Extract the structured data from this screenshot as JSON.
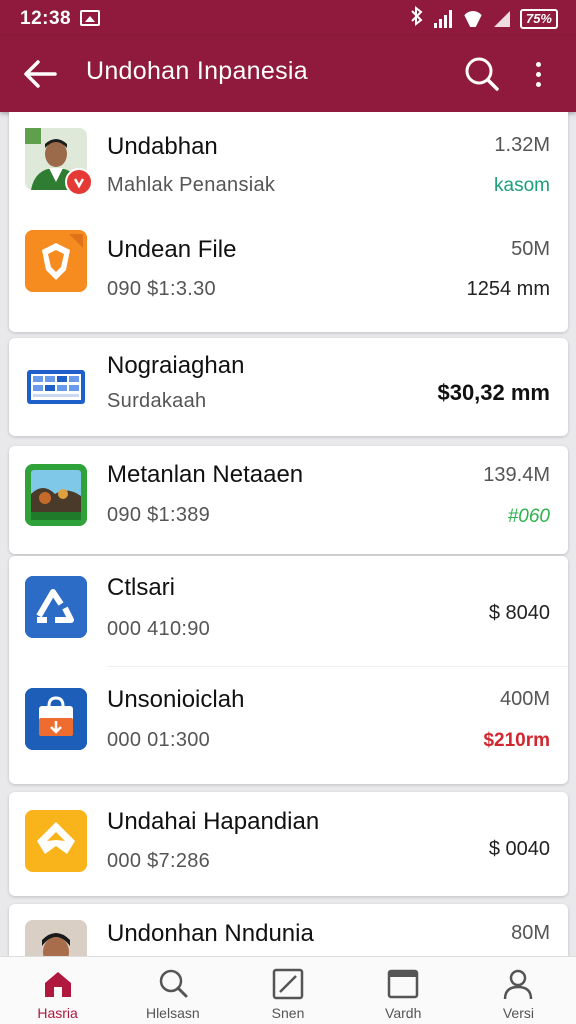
{
  "status_bar": {
    "time": "12:38",
    "battery": "75%"
  },
  "app_bar": {
    "title": "Undohan Inpanesia"
  },
  "items": [
    {
      "name": "Undabhan",
      "subtitle": "Mahlak Penansiak",
      "size": "1.32M",
      "value": "kasom",
      "icon": "avatar-photo"
    },
    {
      "name": "Undean File",
      "subtitle": "090 $1:3.30",
      "size": "50M",
      "value": "1254 mm",
      "icon": "shield-app-icon"
    },
    {
      "name": "Nograiaghan",
      "subtitle": "Surdakaah",
      "size": "",
      "value": "$30,32 mm",
      "icon": "calendar-app-icon"
    },
    {
      "name": "Metanlan Netaaen",
      "subtitle": "090 $1:389",
      "size": "139.4M",
      "value": "#060",
      "icon": "photo-app-icon"
    },
    {
      "name": "Ctlsari",
      "subtitle": "000 410:90",
      "size": "",
      "value": "$ 8040",
      "icon": "recycle-app-icon"
    },
    {
      "name": "Unsonioiclah",
      "subtitle": "000 01:300",
      "size": "400M",
      "value": "$210rm",
      "icon": "bag-app-icon"
    },
    {
      "name": "Undahai Hapandian",
      "subtitle": "000 $7:286",
      "size": "",
      "value": "$ 0040",
      "icon": "diamond-app-icon"
    },
    {
      "name": "Undonhan Nndunia",
      "subtitle": "",
      "size": "80M",
      "value": "",
      "icon": "avatar-photo"
    }
  ],
  "bottom_nav": [
    {
      "label": "Hasria",
      "icon": "home-icon",
      "active": true
    },
    {
      "label": "Hlelsasn",
      "icon": "search-icon",
      "active": false
    },
    {
      "label": "Snen",
      "icon": "edit-icon",
      "active": false
    },
    {
      "label": "Vardh",
      "icon": "window-icon",
      "active": false
    },
    {
      "label": "Versi",
      "icon": "person-icon",
      "active": false
    }
  ],
  "colors": {
    "primary": "#8f1a3d",
    "accent_active": "#b0183e",
    "green": "#2bb24c",
    "red": "#d1262f"
  }
}
